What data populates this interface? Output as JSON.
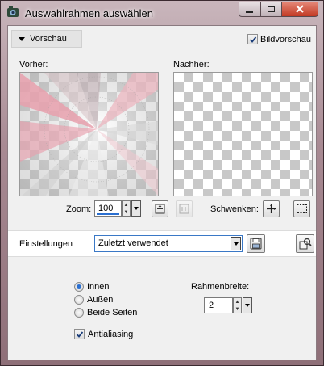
{
  "window": {
    "title": "Auswahlrahmen auswählen",
    "controls": {
      "minimize_glyph": "–",
      "maximize_glyph": "□",
      "close_glyph": "✕"
    }
  },
  "preview": {
    "toggle_label": "Vorschau",
    "bildvorschau_label": "Bildvorschau",
    "bildvorschau_checked": true,
    "before_label": "Vorher:",
    "after_label": "Nachher:"
  },
  "zoom": {
    "label": "Zoom:",
    "value": "100",
    "schwenken_label": "Schwenken:"
  },
  "einstellungen": {
    "label": "Einstellungen",
    "selected": "Zuletzt verwendet"
  },
  "options": {
    "radio": [
      {
        "label": "Innen",
        "checked": true
      },
      {
        "label": "Außen",
        "checked": false
      },
      {
        "label": "Beide Seiten",
        "checked": false
      }
    ],
    "antialiasing_label": "Antialiasing",
    "antialiasing_checked": true,
    "rahmenbreite_label": "Rahmenbreite:",
    "rahmenbreite_value": "2"
  },
  "colors": {
    "accent": "#2a6fd0",
    "close_button": "#c23a24",
    "title_chrome": "#a88a93",
    "preview_pink": "#e8a0ad"
  }
}
